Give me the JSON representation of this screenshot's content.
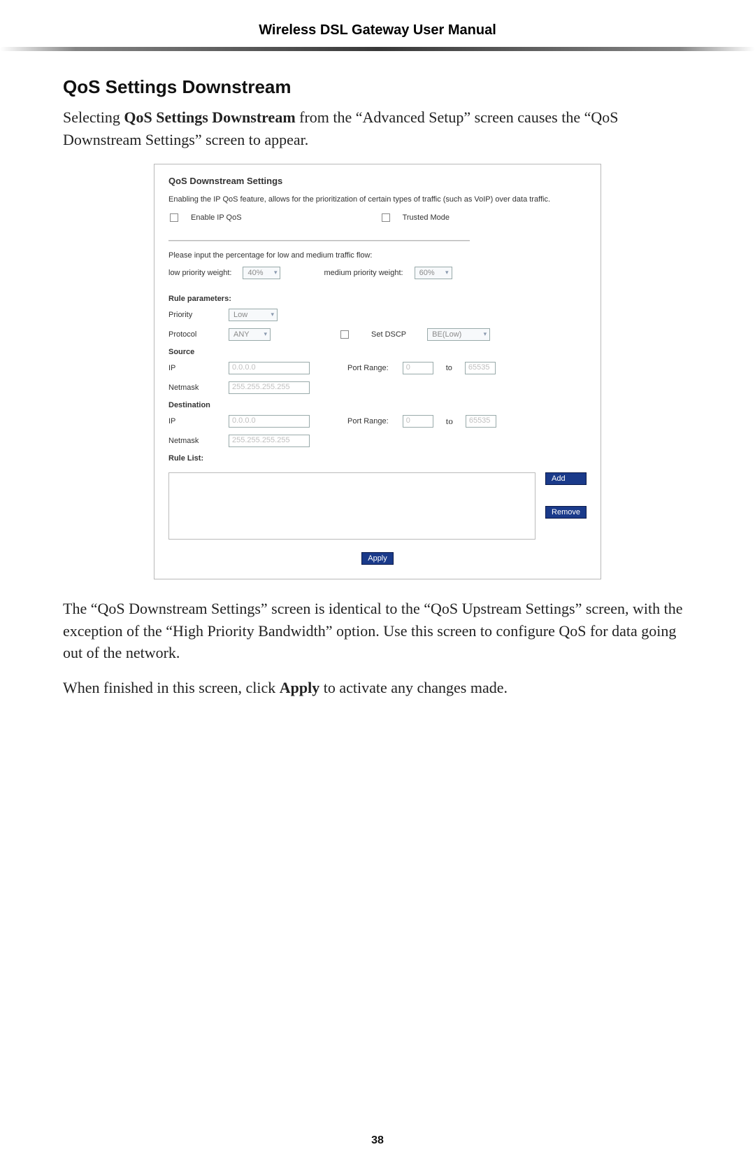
{
  "header": {
    "title": "Wireless DSL Gateway User Manual"
  },
  "section": {
    "heading": "QoS Settings Downstream",
    "intro_pre": "Selecting ",
    "intro_bold": "QoS Settings Downstream",
    "intro_post": " from the “Advanced Setup” screen causes the “QoS Downstream Settings” screen to appear."
  },
  "panel": {
    "title": "QoS Downstream Settings",
    "description": "Enabling the IP QoS feature, allows for the prioritization of certain types of traffic (such as VoIP) over data traffic.",
    "enable_label": "Enable IP QoS",
    "trusted_label": "Trusted Mode",
    "percentage_hint": "Please input the percentage for low and medium traffic flow:",
    "low_weight_label": "low priority weight:",
    "low_weight_value": "40%",
    "med_weight_label": "medium priority weight:",
    "med_weight_value": "60%",
    "rule_params_heading": "Rule parameters:",
    "priority_label": "Priority",
    "priority_value": "Low",
    "protocol_label": "Protocol",
    "protocol_value": "ANY",
    "set_dscp_label": "Set DSCP",
    "dscp_value": "BE(Low)",
    "source_heading": "Source",
    "dest_heading": "Destination",
    "ip_label": "IP",
    "netmask_label": "Netmask",
    "port_range_label": "Port Range:",
    "to_label": "to",
    "src_ip": "0.0.0.0",
    "src_netmask": "255.255.255.255",
    "src_port_from": "0",
    "src_port_to": "65535",
    "dst_ip": "0.0.0.0",
    "dst_netmask": "255.255.255.255",
    "dst_port_from": "0",
    "dst_port_to": "65535",
    "rule_list_heading": "Rule List:",
    "add_btn": "Add",
    "remove_btn": "Remove",
    "apply_btn": "Apply"
  },
  "after": {
    "para1": "The “QoS Downstream Settings” screen is identical to the “QoS Upstream Settings” screen, with the exception of the “High Priority Bandwidth” option. Use this screen to configure QoS for data going out of the network.",
    "para2_pre": "When finished in this screen, click ",
    "para2_bold": "Apply",
    "para2_post": " to activate any changes made."
  },
  "page_number": "38"
}
